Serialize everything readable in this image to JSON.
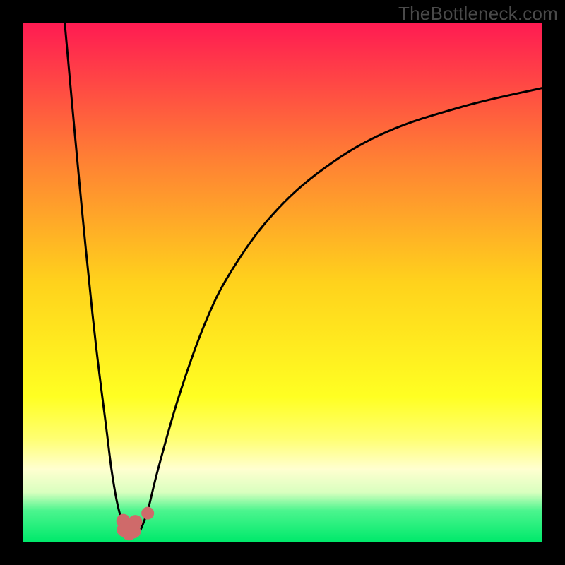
{
  "watermark": "TheBottleneck.com",
  "colors": {
    "frame": "#000000",
    "gradient_top": "#ff1b52",
    "gradient_mid_upper": "#ff8a2c",
    "gradient_mid": "#ffd21c",
    "gradient_mid_lower": "#ffff22",
    "gradient_pale": "#ffffb6",
    "gradient_green": "#00e96b",
    "curve": "#000000",
    "marker": "#cf6a6a"
  },
  "chart_data": {
    "type": "line",
    "title": "",
    "xlabel": "",
    "ylabel": "",
    "x_range": [
      0,
      100
    ],
    "y_range": [
      0,
      100
    ],
    "series": [
      {
        "name": "left-branch",
        "x": [
          8,
          10,
          12,
          14,
          16,
          17,
          18,
          19,
          19.7
        ],
        "y": [
          100,
          78,
          57,
          38,
          22,
          14,
          8,
          4,
          2
        ]
      },
      {
        "name": "right-branch",
        "x": [
          22.5,
          24,
          26,
          30,
          35,
          40,
          48,
          58,
          70,
          85,
          100
        ],
        "y": [
          2,
          6,
          14,
          28,
          42,
          52,
          63,
          72,
          79,
          84,
          87.5
        ]
      },
      {
        "name": "valley-floor",
        "x": [
          19.7,
          20.5,
          21.3,
          22.5
        ],
        "y": [
          2,
          1.3,
          1.3,
          2
        ]
      }
    ],
    "markers": [
      {
        "name": "u-marker-left-down",
        "x": 19.3,
        "y": 4.0
      },
      {
        "name": "u-marker-left-bottom",
        "x": 19.4,
        "y": 2.3
      },
      {
        "name": "u-marker-bottom",
        "x": 20.4,
        "y": 1.6
      },
      {
        "name": "u-marker-right-bottom",
        "x": 21.3,
        "y": 2.0
      },
      {
        "name": "u-marker-right-up",
        "x": 21.6,
        "y": 3.8
      },
      {
        "name": "dot-right",
        "x": 24.0,
        "y": 5.5
      }
    ],
    "gradient_stops": [
      {
        "offset": 0.0,
        "color": "#ff1b52"
      },
      {
        "offset": 0.26,
        "color": "#ff7f34"
      },
      {
        "offset": 0.5,
        "color": "#ffd21c"
      },
      {
        "offset": 0.72,
        "color": "#ffff22"
      },
      {
        "offset": 0.8,
        "color": "#ffff70"
      },
      {
        "offset": 0.86,
        "color": "#ffffd0"
      },
      {
        "offset": 0.905,
        "color": "#d9ffbf"
      },
      {
        "offset": 0.94,
        "color": "#4cf58e"
      },
      {
        "offset": 1.0,
        "color": "#00e96b"
      }
    ]
  }
}
